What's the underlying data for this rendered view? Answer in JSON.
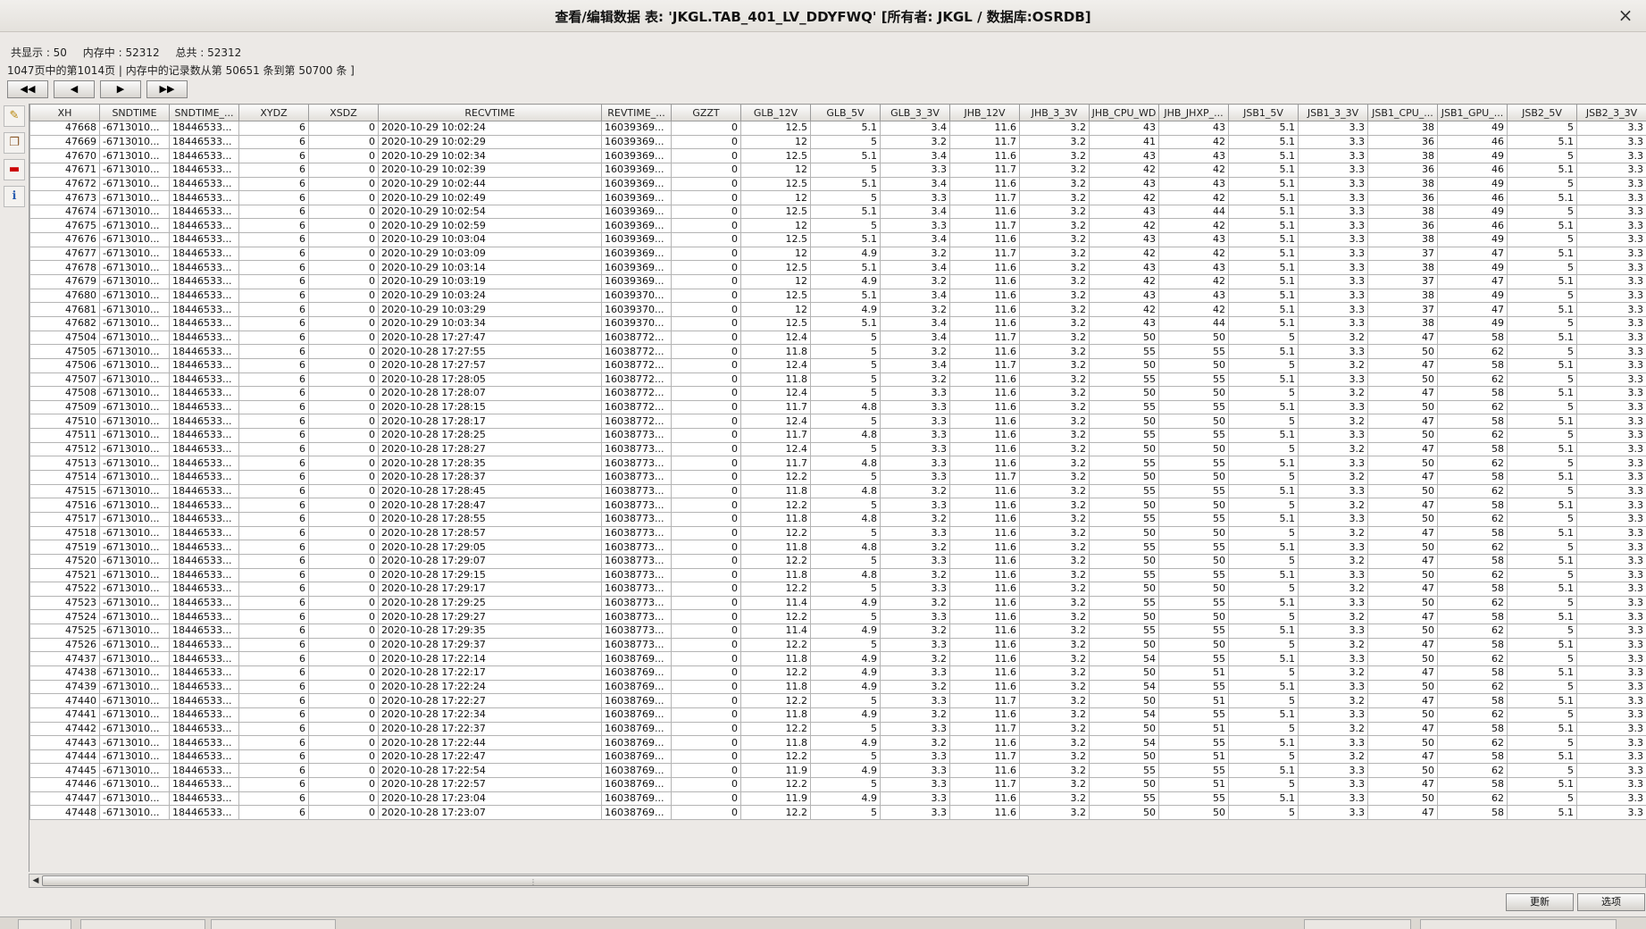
{
  "window": {
    "title": "查看/编辑数据 表: 'JKGL.TAB_401_LV_DDYFWQ' [所有者: JKGL / 数据库:OSRDB]",
    "close_glyph": "×"
  },
  "info": {
    "shown": "共显示 : 50",
    "in_memory": "内存中 : 52312",
    "total": "总共 : 52312",
    "page_info": "1047页中的第1014页 | 内存中的记录数从第 50651 条到第 50700 条 ]"
  },
  "nav": {
    "first": "◀◀",
    "prev": "◀",
    "next": "▶",
    "last": "▶▶"
  },
  "toolbar_icons": [
    "edit-icon",
    "copy-icon",
    "delete-icon",
    "info-icon"
  ],
  "table": {
    "columns": [
      "XH",
      "SNDTIME",
      "SNDTIME_...",
      "XYDZ",
      "XSDZ",
      "RECVTIME",
      "REVTIME_...",
      "GZZT",
      "GLB_12V",
      "GLB_5V",
      "GLB_3_3V",
      "JHB_12V",
      "JHB_3_3V",
      "JHB_CPU_WD",
      "JHB_JHXP_...",
      "JSB1_5V",
      "JSB1_3_3V",
      "JSB1_CPU_...",
      "JSB1_GPU_...",
      "JSB2_5V",
      "JSB2_3_3V"
    ],
    "rows": [
      [
        "47668",
        "-6713010...",
        "18446533...",
        "6",
        "0",
        "2020-10-29 10:02:24",
        "16039369...",
        "0",
        "12.5",
        "5.1",
        "3.4",
        "11.6",
        "3.2",
        "43",
        "43",
        "5.1",
        "3.3",
        "38",
        "49",
        "5",
        "3.3"
      ],
      [
        "47669",
        "-6713010...",
        "18446533...",
        "6",
        "0",
        "2020-10-29 10:02:29",
        "16039369...",
        "0",
        "12",
        "5",
        "3.2",
        "11.7",
        "3.2",
        "41",
        "42",
        "5.1",
        "3.3",
        "36",
        "46",
        "5.1",
        "3.3"
      ],
      [
        "47670",
        "-6713010...",
        "18446533...",
        "6",
        "0",
        "2020-10-29 10:02:34",
        "16039369...",
        "0",
        "12.5",
        "5.1",
        "3.4",
        "11.6",
        "3.2",
        "43",
        "43",
        "5.1",
        "3.3",
        "38",
        "49",
        "5",
        "3.3"
      ],
      [
        "47671",
        "-6713010...",
        "18446533...",
        "6",
        "0",
        "2020-10-29 10:02:39",
        "16039369...",
        "0",
        "12",
        "5",
        "3.3",
        "11.7",
        "3.2",
        "42",
        "42",
        "5.1",
        "3.3",
        "36",
        "46",
        "5.1",
        "3.3"
      ],
      [
        "47672",
        "-6713010...",
        "18446533...",
        "6",
        "0",
        "2020-10-29 10:02:44",
        "16039369...",
        "0",
        "12.5",
        "5.1",
        "3.4",
        "11.6",
        "3.2",
        "43",
        "43",
        "5.1",
        "3.3",
        "38",
        "49",
        "5",
        "3.3"
      ],
      [
        "47673",
        "-6713010...",
        "18446533...",
        "6",
        "0",
        "2020-10-29 10:02:49",
        "16039369...",
        "0",
        "12",
        "5",
        "3.3",
        "11.7",
        "3.2",
        "42",
        "42",
        "5.1",
        "3.3",
        "36",
        "46",
        "5.1",
        "3.3"
      ],
      [
        "47674",
        "-6713010...",
        "18446533...",
        "6",
        "0",
        "2020-10-29 10:02:54",
        "16039369...",
        "0",
        "12.5",
        "5.1",
        "3.4",
        "11.6",
        "3.2",
        "43",
        "44",
        "5.1",
        "3.3",
        "38",
        "49",
        "5",
        "3.3"
      ],
      [
        "47675",
        "-6713010...",
        "18446533...",
        "6",
        "0",
        "2020-10-29 10:02:59",
        "16039369...",
        "0",
        "12",
        "5",
        "3.3",
        "11.7",
        "3.2",
        "42",
        "42",
        "5.1",
        "3.3",
        "36",
        "46",
        "5.1",
        "3.3"
      ],
      [
        "47676",
        "-6713010...",
        "18446533...",
        "6",
        "0",
        "2020-10-29 10:03:04",
        "16039369...",
        "0",
        "12.5",
        "5.1",
        "3.4",
        "11.6",
        "3.2",
        "43",
        "43",
        "5.1",
        "3.3",
        "38",
        "49",
        "5",
        "3.3"
      ],
      [
        "47677",
        "-6713010...",
        "18446533...",
        "6",
        "0",
        "2020-10-29 10:03:09",
        "16039369...",
        "0",
        "12",
        "4.9",
        "3.2",
        "11.7",
        "3.2",
        "42",
        "42",
        "5.1",
        "3.3",
        "37",
        "47",
        "5.1",
        "3.3"
      ],
      [
        "47678",
        "-6713010...",
        "18446533...",
        "6",
        "0",
        "2020-10-29 10:03:14",
        "16039369...",
        "0",
        "12.5",
        "5.1",
        "3.4",
        "11.6",
        "3.2",
        "43",
        "43",
        "5.1",
        "3.3",
        "38",
        "49",
        "5",
        "3.3"
      ],
      [
        "47679",
        "-6713010...",
        "18446533...",
        "6",
        "0",
        "2020-10-29 10:03:19",
        "16039369...",
        "0",
        "12",
        "4.9",
        "3.2",
        "11.6",
        "3.2",
        "42",
        "42",
        "5.1",
        "3.3",
        "37",
        "47",
        "5.1",
        "3.3"
      ],
      [
        "47680",
        "-6713010...",
        "18446533...",
        "6",
        "0",
        "2020-10-29 10:03:24",
        "16039370...",
        "0",
        "12.5",
        "5.1",
        "3.4",
        "11.6",
        "3.2",
        "43",
        "43",
        "5.1",
        "3.3",
        "38",
        "49",
        "5",
        "3.3"
      ],
      [
        "47681",
        "-6713010...",
        "18446533...",
        "6",
        "0",
        "2020-10-29 10:03:29",
        "16039370...",
        "0",
        "12",
        "4.9",
        "3.2",
        "11.6",
        "3.2",
        "42",
        "42",
        "5.1",
        "3.3",
        "37",
        "47",
        "5.1",
        "3.3"
      ],
      [
        "47682",
        "-6713010...",
        "18446533...",
        "6",
        "0",
        "2020-10-29 10:03:34",
        "16039370...",
        "0",
        "12.5",
        "5.1",
        "3.4",
        "11.6",
        "3.2",
        "43",
        "44",
        "5.1",
        "3.3",
        "38",
        "49",
        "5",
        "3.3"
      ],
      [
        "47504",
        "-6713010...",
        "18446533...",
        "6",
        "0",
        "2020-10-28 17:27:47",
        "16038772...",
        "0",
        "12.4",
        "5",
        "3.4",
        "11.7",
        "3.2",
        "50",
        "50",
        "5",
        "3.2",
        "47",
        "58",
        "5.1",
        "3.3"
      ],
      [
        "47505",
        "-6713010...",
        "18446533...",
        "6",
        "0",
        "2020-10-28 17:27:55",
        "16038772...",
        "0",
        "11.8",
        "5",
        "3.2",
        "11.6",
        "3.2",
        "55",
        "55",
        "5.1",
        "3.3",
        "50",
        "62",
        "5",
        "3.3"
      ],
      [
        "47506",
        "-6713010...",
        "18446533...",
        "6",
        "0",
        "2020-10-28 17:27:57",
        "16038772...",
        "0",
        "12.4",
        "5",
        "3.4",
        "11.7",
        "3.2",
        "50",
        "50",
        "5",
        "3.2",
        "47",
        "58",
        "5.1",
        "3.3"
      ],
      [
        "47507",
        "-6713010...",
        "18446533...",
        "6",
        "0",
        "2020-10-28 17:28:05",
        "16038772...",
        "0",
        "11.8",
        "5",
        "3.2",
        "11.6",
        "3.2",
        "55",
        "55",
        "5.1",
        "3.3",
        "50",
        "62",
        "5",
        "3.3"
      ],
      [
        "47508",
        "-6713010...",
        "18446533...",
        "6",
        "0",
        "2020-10-28 17:28:07",
        "16038772...",
        "0",
        "12.4",
        "5",
        "3.3",
        "11.6",
        "3.2",
        "50",
        "50",
        "5",
        "3.2",
        "47",
        "58",
        "5.1",
        "3.3"
      ],
      [
        "47509",
        "-6713010...",
        "18446533...",
        "6",
        "0",
        "2020-10-28 17:28:15",
        "16038772...",
        "0",
        "11.7",
        "4.8",
        "3.3",
        "11.6",
        "3.2",
        "55",
        "55",
        "5.1",
        "3.3",
        "50",
        "62",
        "5",
        "3.3"
      ],
      [
        "47510",
        "-6713010...",
        "18446533...",
        "6",
        "0",
        "2020-10-28 17:28:17",
        "16038772...",
        "0",
        "12.4",
        "5",
        "3.3",
        "11.6",
        "3.2",
        "50",
        "50",
        "5",
        "3.2",
        "47",
        "58",
        "5.1",
        "3.3"
      ],
      [
        "47511",
        "-6713010...",
        "18446533...",
        "6",
        "0",
        "2020-10-28 17:28:25",
        "16038773...",
        "0",
        "11.7",
        "4.8",
        "3.3",
        "11.6",
        "3.2",
        "55",
        "55",
        "5.1",
        "3.3",
        "50",
        "62",
        "5",
        "3.3"
      ],
      [
        "47512",
        "-6713010...",
        "18446533...",
        "6",
        "0",
        "2020-10-28 17:28:27",
        "16038773...",
        "0",
        "12.4",
        "5",
        "3.3",
        "11.6",
        "3.2",
        "50",
        "50",
        "5",
        "3.2",
        "47",
        "58",
        "5.1",
        "3.3"
      ],
      [
        "47513",
        "-6713010...",
        "18446533...",
        "6",
        "0",
        "2020-10-28 17:28:35",
        "16038773...",
        "0",
        "11.7",
        "4.8",
        "3.3",
        "11.6",
        "3.2",
        "55",
        "55",
        "5.1",
        "3.3",
        "50",
        "62",
        "5",
        "3.3"
      ],
      [
        "47514",
        "-6713010...",
        "18446533...",
        "6",
        "0",
        "2020-10-28 17:28:37",
        "16038773...",
        "0",
        "12.2",
        "5",
        "3.3",
        "11.7",
        "3.2",
        "50",
        "50",
        "5",
        "3.2",
        "47",
        "58",
        "5.1",
        "3.3"
      ],
      [
        "47515",
        "-6713010...",
        "18446533...",
        "6",
        "0",
        "2020-10-28 17:28:45",
        "16038773...",
        "0",
        "11.8",
        "4.8",
        "3.2",
        "11.6",
        "3.2",
        "55",
        "55",
        "5.1",
        "3.3",
        "50",
        "62",
        "5",
        "3.3"
      ],
      [
        "47516",
        "-6713010...",
        "18446533...",
        "6",
        "0",
        "2020-10-28 17:28:47",
        "16038773...",
        "0",
        "12.2",
        "5",
        "3.3",
        "11.6",
        "3.2",
        "50",
        "50",
        "5",
        "3.2",
        "47",
        "58",
        "5.1",
        "3.3"
      ],
      [
        "47517",
        "-6713010...",
        "18446533...",
        "6",
        "0",
        "2020-10-28 17:28:55",
        "16038773...",
        "0",
        "11.8",
        "4.8",
        "3.2",
        "11.6",
        "3.2",
        "55",
        "55",
        "5.1",
        "3.3",
        "50",
        "62",
        "5",
        "3.3"
      ],
      [
        "47518",
        "-6713010...",
        "18446533...",
        "6",
        "0",
        "2020-10-28 17:28:57",
        "16038773...",
        "0",
        "12.2",
        "5",
        "3.3",
        "11.6",
        "3.2",
        "50",
        "50",
        "5",
        "3.2",
        "47",
        "58",
        "5.1",
        "3.3"
      ],
      [
        "47519",
        "-6713010...",
        "18446533...",
        "6",
        "0",
        "2020-10-28 17:29:05",
        "16038773...",
        "0",
        "11.8",
        "4.8",
        "3.2",
        "11.6",
        "3.2",
        "55",
        "55",
        "5.1",
        "3.3",
        "50",
        "62",
        "5",
        "3.3"
      ],
      [
        "47520",
        "-6713010...",
        "18446533...",
        "6",
        "0",
        "2020-10-28 17:29:07",
        "16038773...",
        "0",
        "12.2",
        "5",
        "3.3",
        "11.6",
        "3.2",
        "50",
        "50",
        "5",
        "3.2",
        "47",
        "58",
        "5.1",
        "3.3"
      ],
      [
        "47521",
        "-6713010...",
        "18446533...",
        "6",
        "0",
        "2020-10-28 17:29:15",
        "16038773...",
        "0",
        "11.8",
        "4.8",
        "3.2",
        "11.6",
        "3.2",
        "55",
        "55",
        "5.1",
        "3.3",
        "50",
        "62",
        "5",
        "3.3"
      ],
      [
        "47522",
        "-6713010...",
        "18446533...",
        "6",
        "0",
        "2020-10-28 17:29:17",
        "16038773...",
        "0",
        "12.2",
        "5",
        "3.3",
        "11.6",
        "3.2",
        "50",
        "50",
        "5",
        "3.2",
        "47",
        "58",
        "5.1",
        "3.3"
      ],
      [
        "47523",
        "-6713010...",
        "18446533...",
        "6",
        "0",
        "2020-10-28 17:29:25",
        "16038773...",
        "0",
        "11.4",
        "4.9",
        "3.2",
        "11.6",
        "3.2",
        "55",
        "55",
        "5.1",
        "3.3",
        "50",
        "62",
        "5",
        "3.3"
      ],
      [
        "47524",
        "-6713010...",
        "18446533...",
        "6",
        "0",
        "2020-10-28 17:29:27",
        "16038773...",
        "0",
        "12.2",
        "5",
        "3.3",
        "11.6",
        "3.2",
        "50",
        "50",
        "5",
        "3.2",
        "47",
        "58",
        "5.1",
        "3.3"
      ],
      [
        "47525",
        "-6713010...",
        "18446533...",
        "6",
        "0",
        "2020-10-28 17:29:35",
        "16038773...",
        "0",
        "11.4",
        "4.9",
        "3.2",
        "11.6",
        "3.2",
        "55",
        "55",
        "5.1",
        "3.3",
        "50",
        "62",
        "5",
        "3.3"
      ],
      [
        "47526",
        "-6713010...",
        "18446533...",
        "6",
        "0",
        "2020-10-28 17:29:37",
        "16038773...",
        "0",
        "12.2",
        "5",
        "3.3",
        "11.6",
        "3.2",
        "50",
        "50",
        "5",
        "3.2",
        "47",
        "58",
        "5.1",
        "3.3"
      ],
      [
        "47437",
        "-6713010...",
        "18446533...",
        "6",
        "0",
        "2020-10-28 17:22:14",
        "16038769...",
        "0",
        "11.8",
        "4.9",
        "3.2",
        "11.6",
        "3.2",
        "54",
        "55",
        "5.1",
        "3.3",
        "50",
        "62",
        "5",
        "3.3"
      ],
      [
        "47438",
        "-6713010...",
        "18446533...",
        "6",
        "0",
        "2020-10-28 17:22:17",
        "16038769...",
        "0",
        "12.2",
        "4.9",
        "3.3",
        "11.6",
        "3.2",
        "50",
        "51",
        "5",
        "3.2",
        "47",
        "58",
        "5.1",
        "3.3"
      ],
      [
        "47439",
        "-6713010...",
        "18446533...",
        "6",
        "0",
        "2020-10-28 17:22:24",
        "16038769...",
        "0",
        "11.8",
        "4.9",
        "3.2",
        "11.6",
        "3.2",
        "54",
        "55",
        "5.1",
        "3.3",
        "50",
        "62",
        "5",
        "3.3"
      ],
      [
        "47440",
        "-6713010...",
        "18446533...",
        "6",
        "0",
        "2020-10-28 17:22:27",
        "16038769...",
        "0",
        "12.2",
        "5",
        "3.3",
        "11.7",
        "3.2",
        "50",
        "51",
        "5",
        "3.2",
        "47",
        "58",
        "5.1",
        "3.3"
      ],
      [
        "47441",
        "-6713010...",
        "18446533...",
        "6",
        "0",
        "2020-10-28 17:22:34",
        "16038769...",
        "0",
        "11.8",
        "4.9",
        "3.2",
        "11.6",
        "3.2",
        "54",
        "55",
        "5.1",
        "3.3",
        "50",
        "62",
        "5",
        "3.3"
      ],
      [
        "47442",
        "-6713010...",
        "18446533...",
        "6",
        "0",
        "2020-10-28 17:22:37",
        "16038769...",
        "0",
        "12.2",
        "5",
        "3.3",
        "11.7",
        "3.2",
        "50",
        "51",
        "5",
        "3.2",
        "47",
        "58",
        "5.1",
        "3.3"
      ],
      [
        "47443",
        "-6713010...",
        "18446533...",
        "6",
        "0",
        "2020-10-28 17:22:44",
        "16038769...",
        "0",
        "11.8",
        "4.9",
        "3.2",
        "11.6",
        "3.2",
        "54",
        "55",
        "5.1",
        "3.3",
        "50",
        "62",
        "5",
        "3.3"
      ],
      [
        "47444",
        "-6713010...",
        "18446533...",
        "6",
        "0",
        "2020-10-28 17:22:47",
        "16038769...",
        "0",
        "12.2",
        "5",
        "3.3",
        "11.7",
        "3.2",
        "50",
        "51",
        "5",
        "3.2",
        "47",
        "58",
        "5.1",
        "3.3"
      ],
      [
        "47445",
        "-6713010...",
        "18446533...",
        "6",
        "0",
        "2020-10-28 17:22:54",
        "16038769...",
        "0",
        "11.9",
        "4.9",
        "3.3",
        "11.6",
        "3.2",
        "55",
        "55",
        "5.1",
        "3.3",
        "50",
        "62",
        "5",
        "3.3"
      ],
      [
        "47446",
        "-6713010...",
        "18446533...",
        "6",
        "0",
        "2020-10-28 17:22:57",
        "16038769...",
        "0",
        "12.2",
        "5",
        "3.3",
        "11.7",
        "3.2",
        "50",
        "51",
        "5",
        "3.3",
        "47",
        "58",
        "5.1",
        "3.3"
      ],
      [
        "47447",
        "-6713010...",
        "18446533...",
        "6",
        "0",
        "2020-10-28 17:23:04",
        "16038769...",
        "0",
        "11.9",
        "4.9",
        "3.3",
        "11.6",
        "3.2",
        "55",
        "55",
        "5.1",
        "3.3",
        "50",
        "62",
        "5",
        "3.3"
      ],
      [
        "47448",
        "-6713010...",
        "18446533...",
        "6",
        "0",
        "2020-10-28 17:23:07",
        "16038769...",
        "0",
        "12.2",
        "5",
        "3.3",
        "11.6",
        "3.2",
        "50",
        "50",
        "5",
        "3.3",
        "47",
        "58",
        "5.1",
        "3.3"
      ]
    ]
  },
  "buttons": {
    "update": "更新",
    "options": "选项"
  }
}
